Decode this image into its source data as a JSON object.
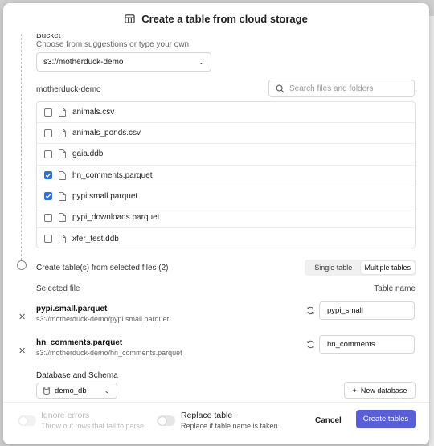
{
  "dialog": {
    "title": "Create a table from cloud storage"
  },
  "bucket": {
    "label": "Bucket",
    "hint": "Choose from suggestions or type your own",
    "value": "s3://motherduck-demo"
  },
  "browser": {
    "folder": "motherduck-demo",
    "search_placeholder": "Search files and folders",
    "files": [
      {
        "name": "animals.csv",
        "checked": false
      },
      {
        "name": "animals_ponds.csv",
        "checked": false
      },
      {
        "name": "gaia.ddb",
        "checked": false
      },
      {
        "name": "hn_comments.parquet",
        "checked": true
      },
      {
        "name": "pypi.small.parquet",
        "checked": true
      },
      {
        "name": "pypi_downloads.parquet",
        "checked": false
      },
      {
        "name": "xfer_test.ddb",
        "checked": false
      }
    ]
  },
  "step2": {
    "title": "Create table(s) from selected files (2)",
    "mode_single": "Single table",
    "mode_multiple": "Multiple tables",
    "active_mode": "Multiple tables",
    "col_selected_file": "Selected file",
    "col_table_name": "Table name",
    "selected": [
      {
        "file": "pypi.small.parquet",
        "path": "s3://motherduck-demo/pypi.small.parquet",
        "table": "pypi_small"
      },
      {
        "file": "hn_comments.parquet",
        "path": "s3://motherduck-demo/hn_comments.parquet",
        "table": "hn_comments"
      }
    ],
    "db_label": "Database and Schema",
    "db_value": "demo_db",
    "new_db_label": "New database"
  },
  "footer": {
    "ignore_errors_title": "Ignore errors",
    "ignore_errors_sub": "Throw out rows that fail to parse",
    "replace_title": "Replace table",
    "replace_sub": "Replace if table name is taken",
    "cancel_label": "Cancel",
    "create_label": "Create tables"
  },
  "colors": {
    "accent": "#5b5fd6",
    "checkbox": "#2d6fdc"
  }
}
